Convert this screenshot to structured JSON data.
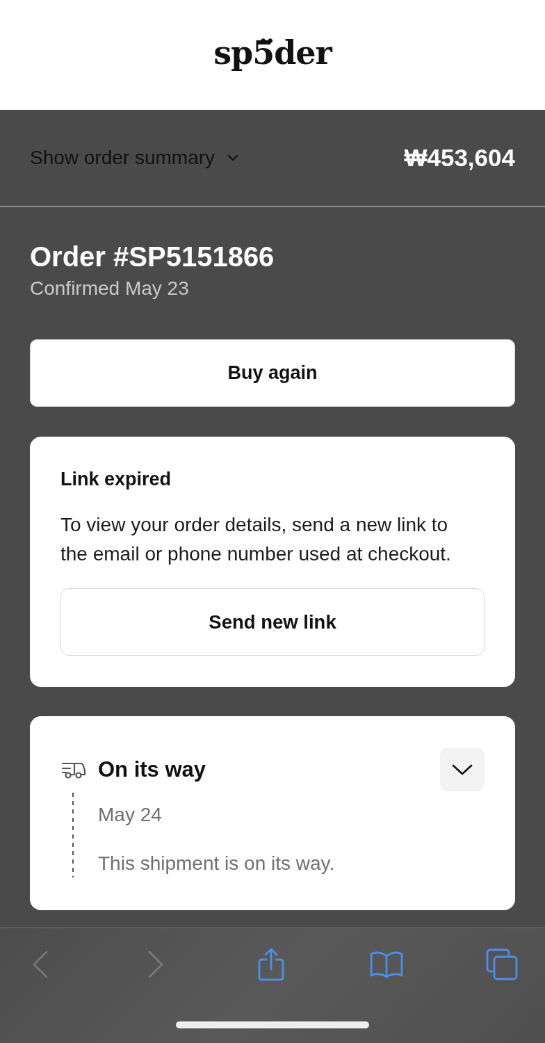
{
  "header": {
    "logo": "sp5̈der"
  },
  "summary_bar": {
    "toggle_label": "Show order summary",
    "expanded": false,
    "total": "₩453,604"
  },
  "order": {
    "title": "Order #SP5151866",
    "confirmed": "Confirmed May 23",
    "buy_again_button": "Buy again"
  },
  "link_card": {
    "title": "Link expired",
    "message": "To view your order details, send a new link to the email or phone number used at checkout.",
    "button": "Send new link"
  },
  "shipment": {
    "status": "On its way",
    "expanded": false,
    "date": "May 24",
    "message": "This shipment is on its way."
  },
  "browser_toolbar": {
    "buttons": [
      {
        "kind": "back",
        "disabled": true
      },
      {
        "kind": "forward",
        "disabled": true
      },
      {
        "kind": "share",
        "disabled": false
      },
      {
        "kind": "bookmarks",
        "disabled": false
      },
      {
        "kind": "tabs",
        "disabled": false
      }
    ]
  }
}
